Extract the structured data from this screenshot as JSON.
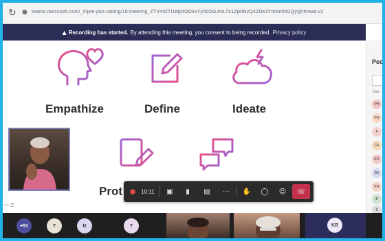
{
  "browser": {
    "reload_icon": "reload-icon",
    "lock_icon": "lock-icon",
    "url": "teams.microsoft.com/_#/pre-join-calling/19:meeting_ZTVmOTI1MjktODkxYy00OGJmLTk1ZjEtNzQ4ZDk3YmNmNGQy@thread.v2"
  },
  "banner": {
    "icon": "warning-icon",
    "bold_text": "Recording has started.",
    "text": "By attending this meeting, you consent to being recorded.",
    "link": "Privacy policy"
  },
  "slide": {
    "captions": [
      "Empathize",
      "Define",
      "Ideate",
      "Prot"
    ]
  },
  "toolbar": {
    "time": "10:11",
    "recording_icon": "record-dot-icon",
    "camera_icon": "camera-icon",
    "mic_icon": "mic-icon",
    "share_icon": "share-screen-icon",
    "more_icon": "more-icon",
    "raise_hand_icon": "raise-hand-icon",
    "chat_icon": "chat-icon",
    "people_icon": "people-icon",
    "hangup_icon": "hang-up-icon"
  },
  "stage_footer": "• • ☰",
  "strip": {
    "overflow_count": "+51",
    "avatars": [
      "T",
      "D",
      "T"
    ],
    "last_avatar": "KB"
  },
  "sidebar": {
    "title": "Peo",
    "section": "Curr",
    "entries": [
      "PH",
      "PH",
      "F",
      "FA",
      "EO",
      "BE",
      "KA",
      "B",
      "S"
    ]
  },
  "colors": {
    "accent_pink": "#e8508a",
    "accent_purple": "#9a63d6",
    "banner_bg": "#2b2d56",
    "hangup_red": "#c4314b",
    "frame_blue": "#22b2e6"
  }
}
